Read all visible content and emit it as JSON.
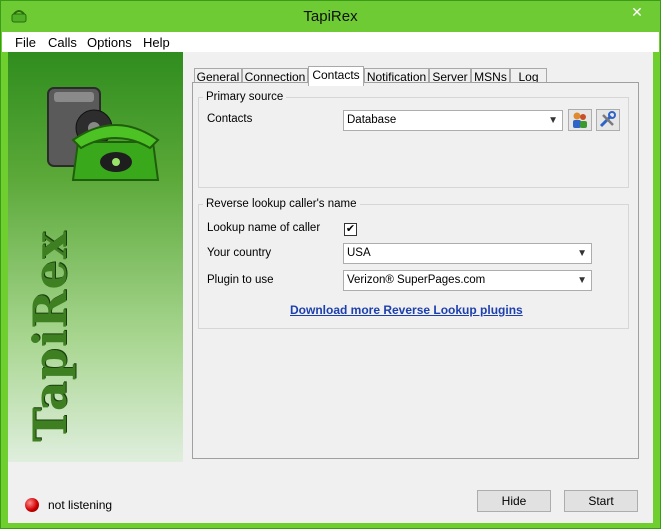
{
  "window": {
    "title": "TapiRex",
    "close_glyph": "✕"
  },
  "menu": {
    "items": [
      "File",
      "Calls",
      "Options",
      "Help"
    ]
  },
  "sidebar": {
    "brand": "TapiRex"
  },
  "tabs": [
    "General",
    "Connection",
    "Contacts",
    "Notification",
    "Server",
    "MSNs",
    "Log"
  ],
  "active_tab": "Contacts",
  "primary_source": {
    "title": "Primary source",
    "contacts_label": "Contacts",
    "contacts_value": "Database"
  },
  "reverse_lookup": {
    "title": "Reverse lookup caller's name",
    "lookup_label": "Lookup name of caller",
    "lookup_checked": true,
    "country_label": "Your country",
    "country_value": "USA",
    "plugin_label": "Plugin to use",
    "plugin_value": "Verizon® SuperPages.com",
    "download_link": "Download more Reverse Lookup plugins"
  },
  "status": {
    "text": "not listening",
    "color": "#d10000"
  },
  "buttons": {
    "hide": "Hide",
    "start": "Start"
  },
  "icons": {
    "app": "phone-icon",
    "contacts_people": "people-icon",
    "contacts_settings": "tools-icon",
    "dropdown": "chevron-down-icon"
  }
}
